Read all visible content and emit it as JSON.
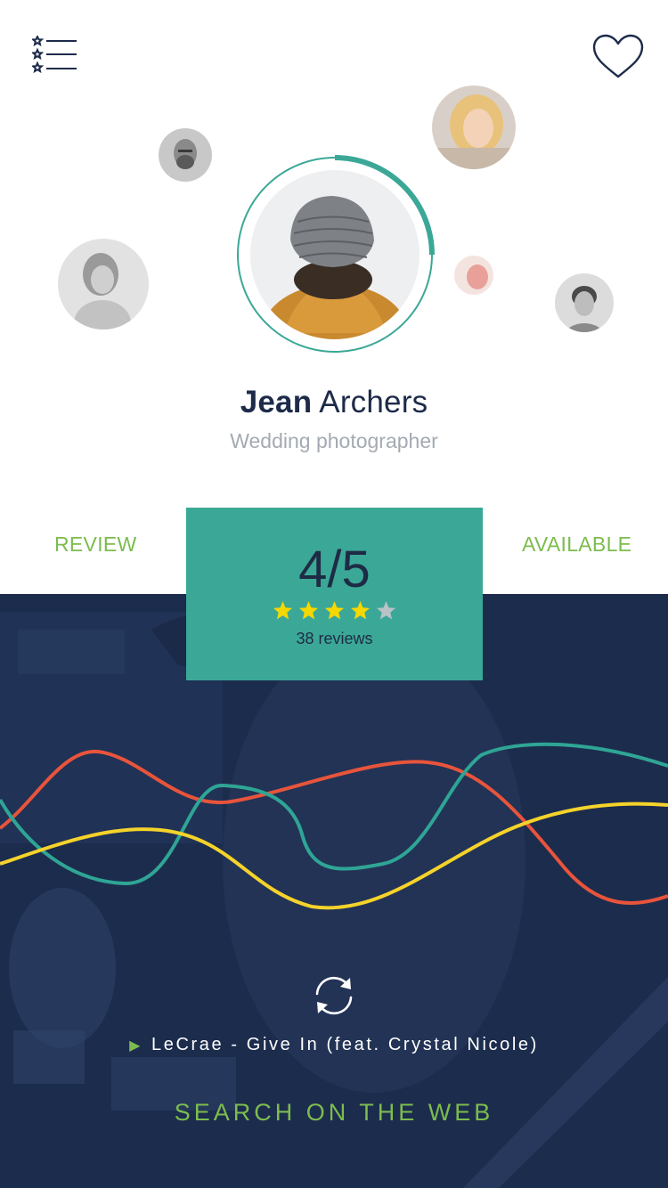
{
  "profile": {
    "first_name": "Jean",
    "last_name": "Archers",
    "title": "Wedding photographer"
  },
  "stats": {
    "review_label": "REVIEW",
    "available_label": "AVAILABLE"
  },
  "rating": {
    "value_text": "4/5",
    "value": 4,
    "max": 5,
    "reviews_text": "38 reviews",
    "profile_progress_fraction": 0.25
  },
  "player": {
    "track": "LeCrae - Give In (feat. Crystal Nicole)"
  },
  "actions": {
    "search_web": "SEARCH ON THE WEB"
  },
  "icons": {
    "menu": "star-list-menu-icon",
    "favorite": "heart-icon",
    "refresh": "refresh-icon",
    "play": "play-icon",
    "star": "star-icon"
  },
  "colors": {
    "accent_teal": "#3ba897",
    "accent_green": "#7cbc4f",
    "navy": "#1c2c4d",
    "wave_red": "#e8543b",
    "wave_teal": "#2fa595",
    "wave_yellow": "#f5d32a",
    "star_filled": "#f5d800",
    "star_empty": "#b8c2c7"
  }
}
